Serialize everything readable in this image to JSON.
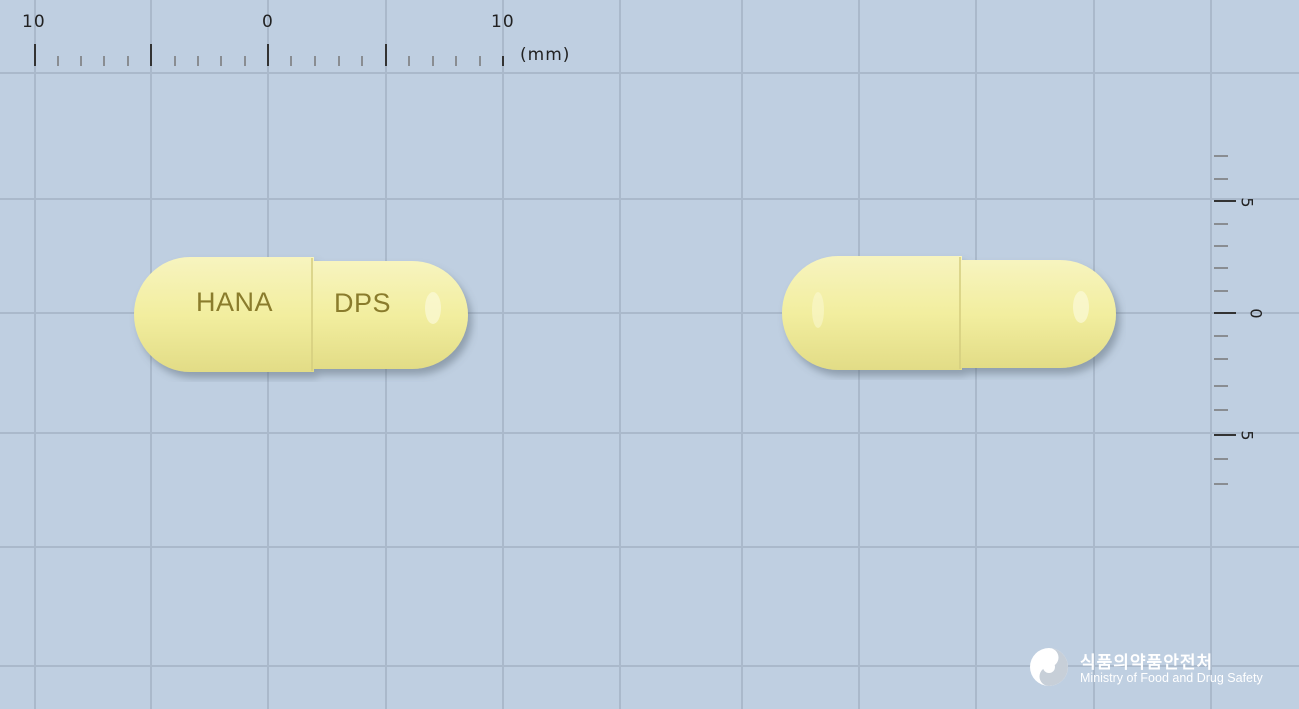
{
  "ruler_top": {
    "labels": [
      "10",
      "0",
      "10"
    ],
    "unit": "(mm)"
  },
  "ruler_right": {
    "labels": [
      "5",
      "0",
      "5"
    ]
  },
  "capsule_front": {
    "imprint_left": "HANA",
    "imprint_right": "DPS",
    "color": "#f3f0a8"
  },
  "capsule_back": {
    "color": "#f3f0a8"
  },
  "logo": {
    "name_ko": "식품의약품안전처",
    "name_en": "Ministry of Food and Drug Safety"
  },
  "colors": {
    "background": "#bfcfe1",
    "grid": "#a9b9cc"
  }
}
